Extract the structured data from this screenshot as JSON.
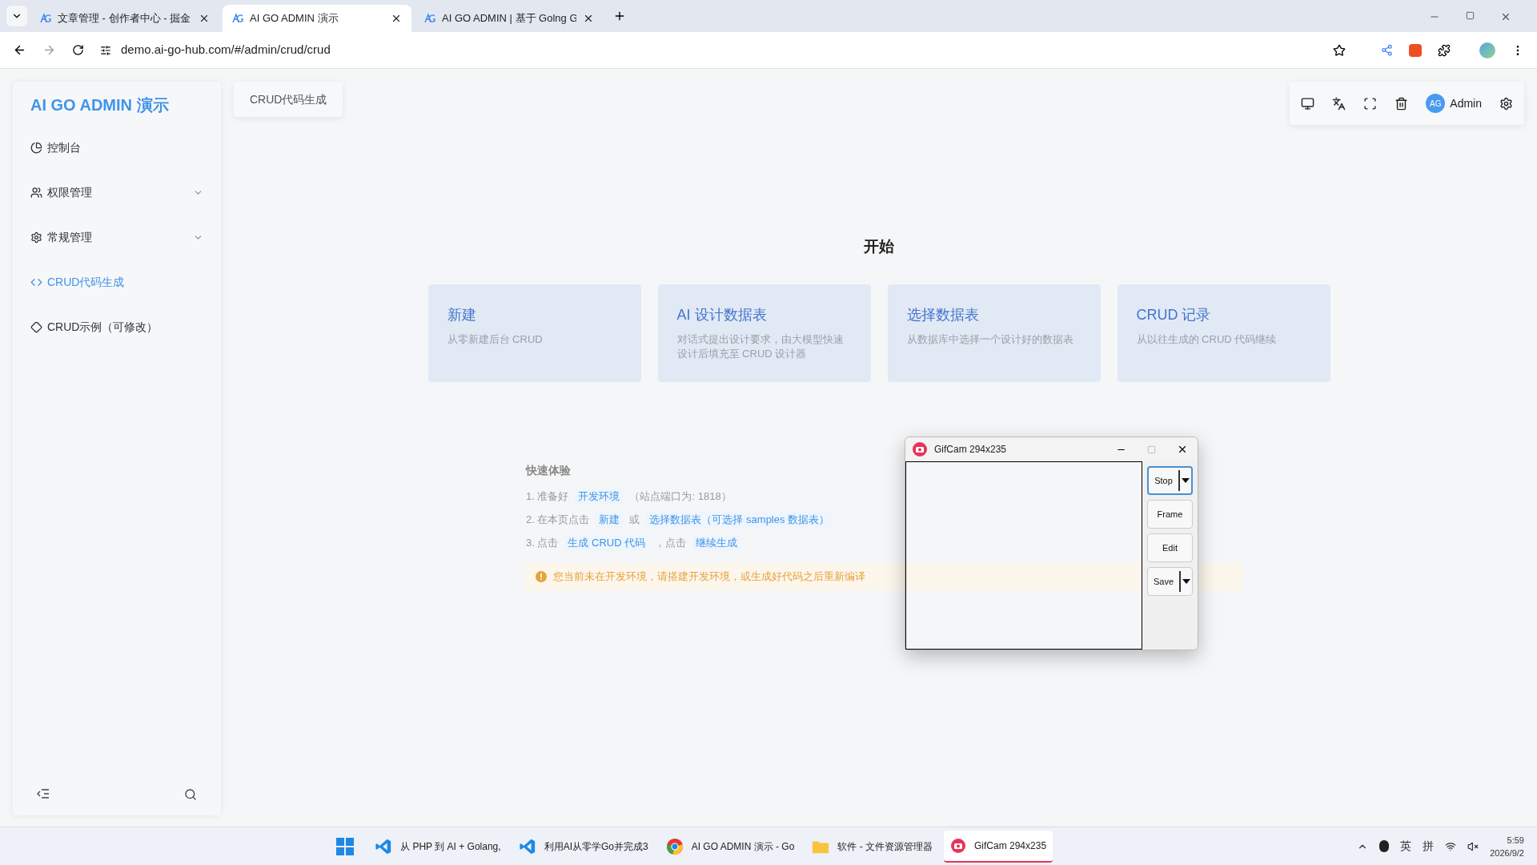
{
  "browser": {
    "tabs": [
      {
        "title": "文章管理 - 创作者中心 - 掘金",
        "selected": false
      },
      {
        "title": "AI GO ADMIN 演示",
        "selected": true
      },
      {
        "title": "AI GO ADMIN | 基于 Golng G",
        "selected": false
      }
    ],
    "url": "demo.ai-go-hub.com/#/admin/crud/crud"
  },
  "sidebar": {
    "title": "AI GO ADMIN 演示",
    "items": [
      {
        "label": "控制台",
        "kind": "link",
        "selected": false
      },
      {
        "label": "权限管理",
        "kind": "group",
        "selected": false
      },
      {
        "label": "常规管理",
        "kind": "group",
        "selected": false
      },
      {
        "label": "CRUD代码生成",
        "kind": "link",
        "selected": true
      },
      {
        "label": "CRUD示例（可修改）",
        "kind": "link",
        "selected": false
      }
    ]
  },
  "header": {
    "page_tabs": [
      {
        "label": "CRUD代码生成",
        "selected": true
      }
    ],
    "avatar": "AG",
    "user": "Admin"
  },
  "main": {
    "heading": "开始",
    "cards": [
      {
        "title": "新建",
        "description": "从零新建后台 CRUD"
      },
      {
        "title": "AI 设计数据表",
        "description": "对话式提出设计要求，由大模型快速设计后填充至 CRUD 设计器"
      },
      {
        "title": "选择数据表",
        "description": "从数据库中选择一个设计好的数据表"
      },
      {
        "title": "CRUD 记录",
        "description": "从以往生成的 CRUD 代码继续"
      }
    ],
    "guide": {
      "title": "快速体验",
      "steps": [
        [
          {
            "kind": "plain",
            "text": "1. 准备好"
          },
          {
            "kind": "link",
            "text": "开发环境"
          },
          {
            "kind": "plain",
            "text": "（站点端口为: 1818）"
          }
        ],
        [
          {
            "kind": "plain",
            "text": "2. 在本页点击"
          },
          {
            "kind": "link",
            "text": "新建"
          },
          {
            "kind": "plain",
            "text": "或"
          },
          {
            "kind": "link",
            "text": "选择数据表（可选择 samples 数据表）"
          }
        ],
        [
          {
            "kind": "plain",
            "text": "3. 点击"
          },
          {
            "kind": "link",
            "text": "生成 CRUD 代码"
          },
          {
            "kind": "plain",
            "text": "，点击"
          },
          {
            "kind": "link",
            "text": "继续生成"
          }
        ]
      ]
    },
    "warning": "您当前未在开发环境，请搭建开发环境，或生成好代码之后重新编译"
  },
  "gifcam": {
    "title": "GifCam 294x235",
    "buttons": [
      {
        "label": "Stop",
        "dropdown": true,
        "focused": true
      },
      {
        "label": "Frame",
        "dropdown": false,
        "focused": false
      },
      {
        "label": "Edit",
        "dropdown": false,
        "focused": false
      },
      {
        "label": "Save",
        "dropdown": true,
        "focused": false
      }
    ]
  },
  "taskbar": {
    "items": [
      {
        "label": "从 PHP 到 AI + Golang,",
        "active": false
      },
      {
        "label": "利用AI从零学Go并完成3",
        "active": false
      },
      {
        "label": "AI GO ADMIN 演示 - Go",
        "active": false
      },
      {
        "label": "软件 - 文件资源管理器",
        "active": false
      },
      {
        "label": "GifCam 294x235",
        "active": true
      }
    ],
    "ime": [
      "英",
      "拼"
    ],
    "time": "5:59",
    "date": "2026/9/2"
  }
}
